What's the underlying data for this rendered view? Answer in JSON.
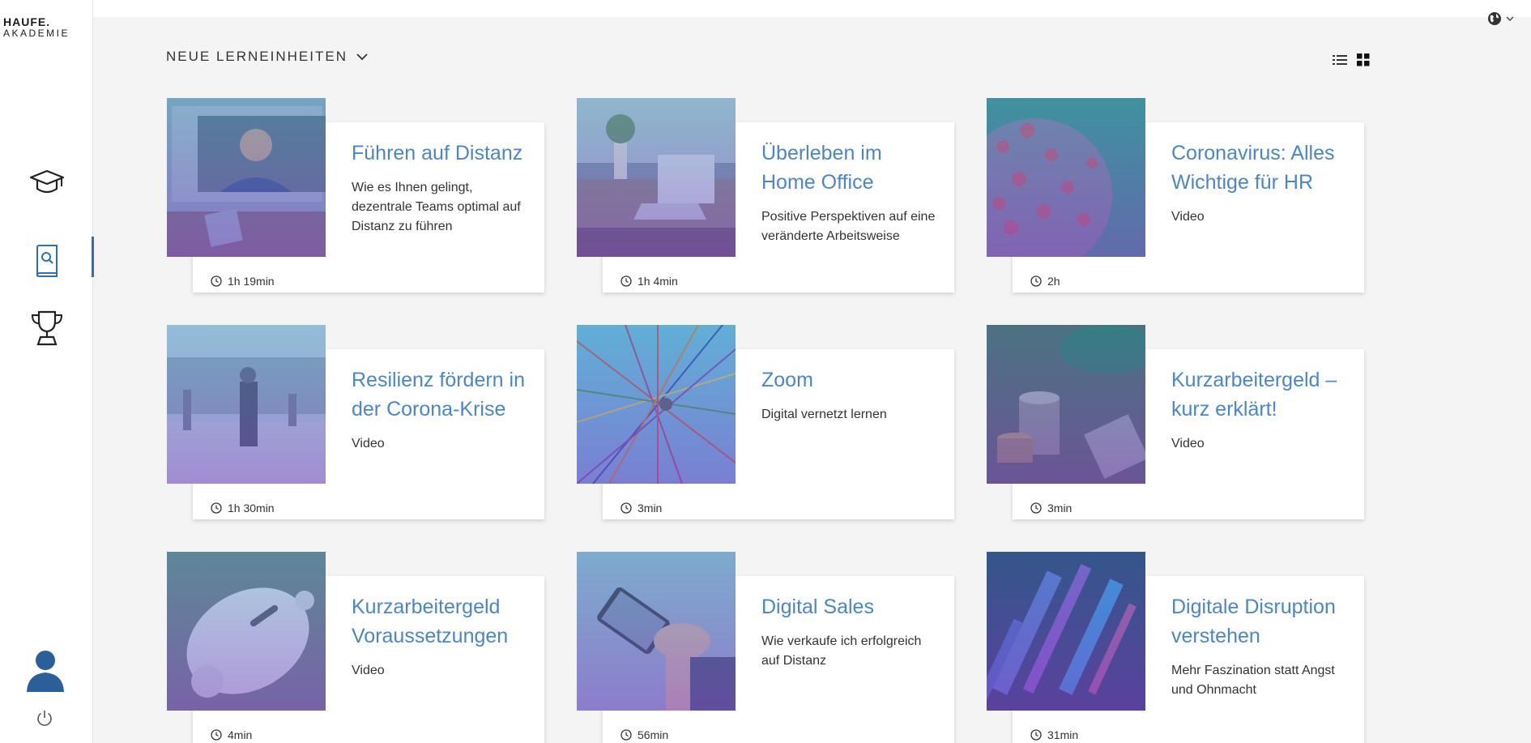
{
  "brand": {
    "line1": "HAUFE.",
    "line2": "AKADEMIE"
  },
  "section": {
    "title": "NEUE LERNEINHEITEN"
  },
  "cards": [
    {
      "title": "Führen auf Distanz",
      "desc": "Wie es Ihnen gelingt, dezentrale Teams optimal auf Distanz zu führen",
      "duration": "1h 19min"
    },
    {
      "title": "Überleben im Home Office",
      "desc": "Positive Perspektiven auf eine veränderte Arbeitsweise",
      "duration": "1h 4min"
    },
    {
      "title": "Coronavirus: Alles Wichtige für HR",
      "desc": "Video",
      "duration": "2h"
    },
    {
      "title": "Resilienz fördern in der Corona-Krise",
      "desc": "Video",
      "duration": "1h 30min"
    },
    {
      "title": "Zoom",
      "desc": "Digital vernetzt lernen",
      "duration": "3min"
    },
    {
      "title": "Kurzarbeitergeld – kurz erklärt!",
      "desc": "Video",
      "duration": "3min"
    },
    {
      "title": "Kurzarbeitergeld Voraussetzungen",
      "desc": "Video",
      "duration": "4min"
    },
    {
      "title": "Digital Sales",
      "desc": "Wie verkaufe ich erfolgreich auf Distanz",
      "duration": "56min"
    },
    {
      "title": "Digitale Disruption verstehen",
      "desc": "Mehr Faszination statt Angst und Ohnmacht",
      "duration": "31min"
    }
  ],
  "colors": {
    "accent": "#4a86c8",
    "active_nav": "#2c6fbb",
    "background": "#f4f4f4"
  },
  "icons": {
    "nav": [
      "graduation-cap-icon",
      "book-search-icon",
      "trophy-icon"
    ],
    "user": "user-avatar-icon",
    "logout": "power-icon",
    "language": "globe-icon",
    "view": [
      "list-view-icon",
      "grid-view-icon"
    ]
  }
}
